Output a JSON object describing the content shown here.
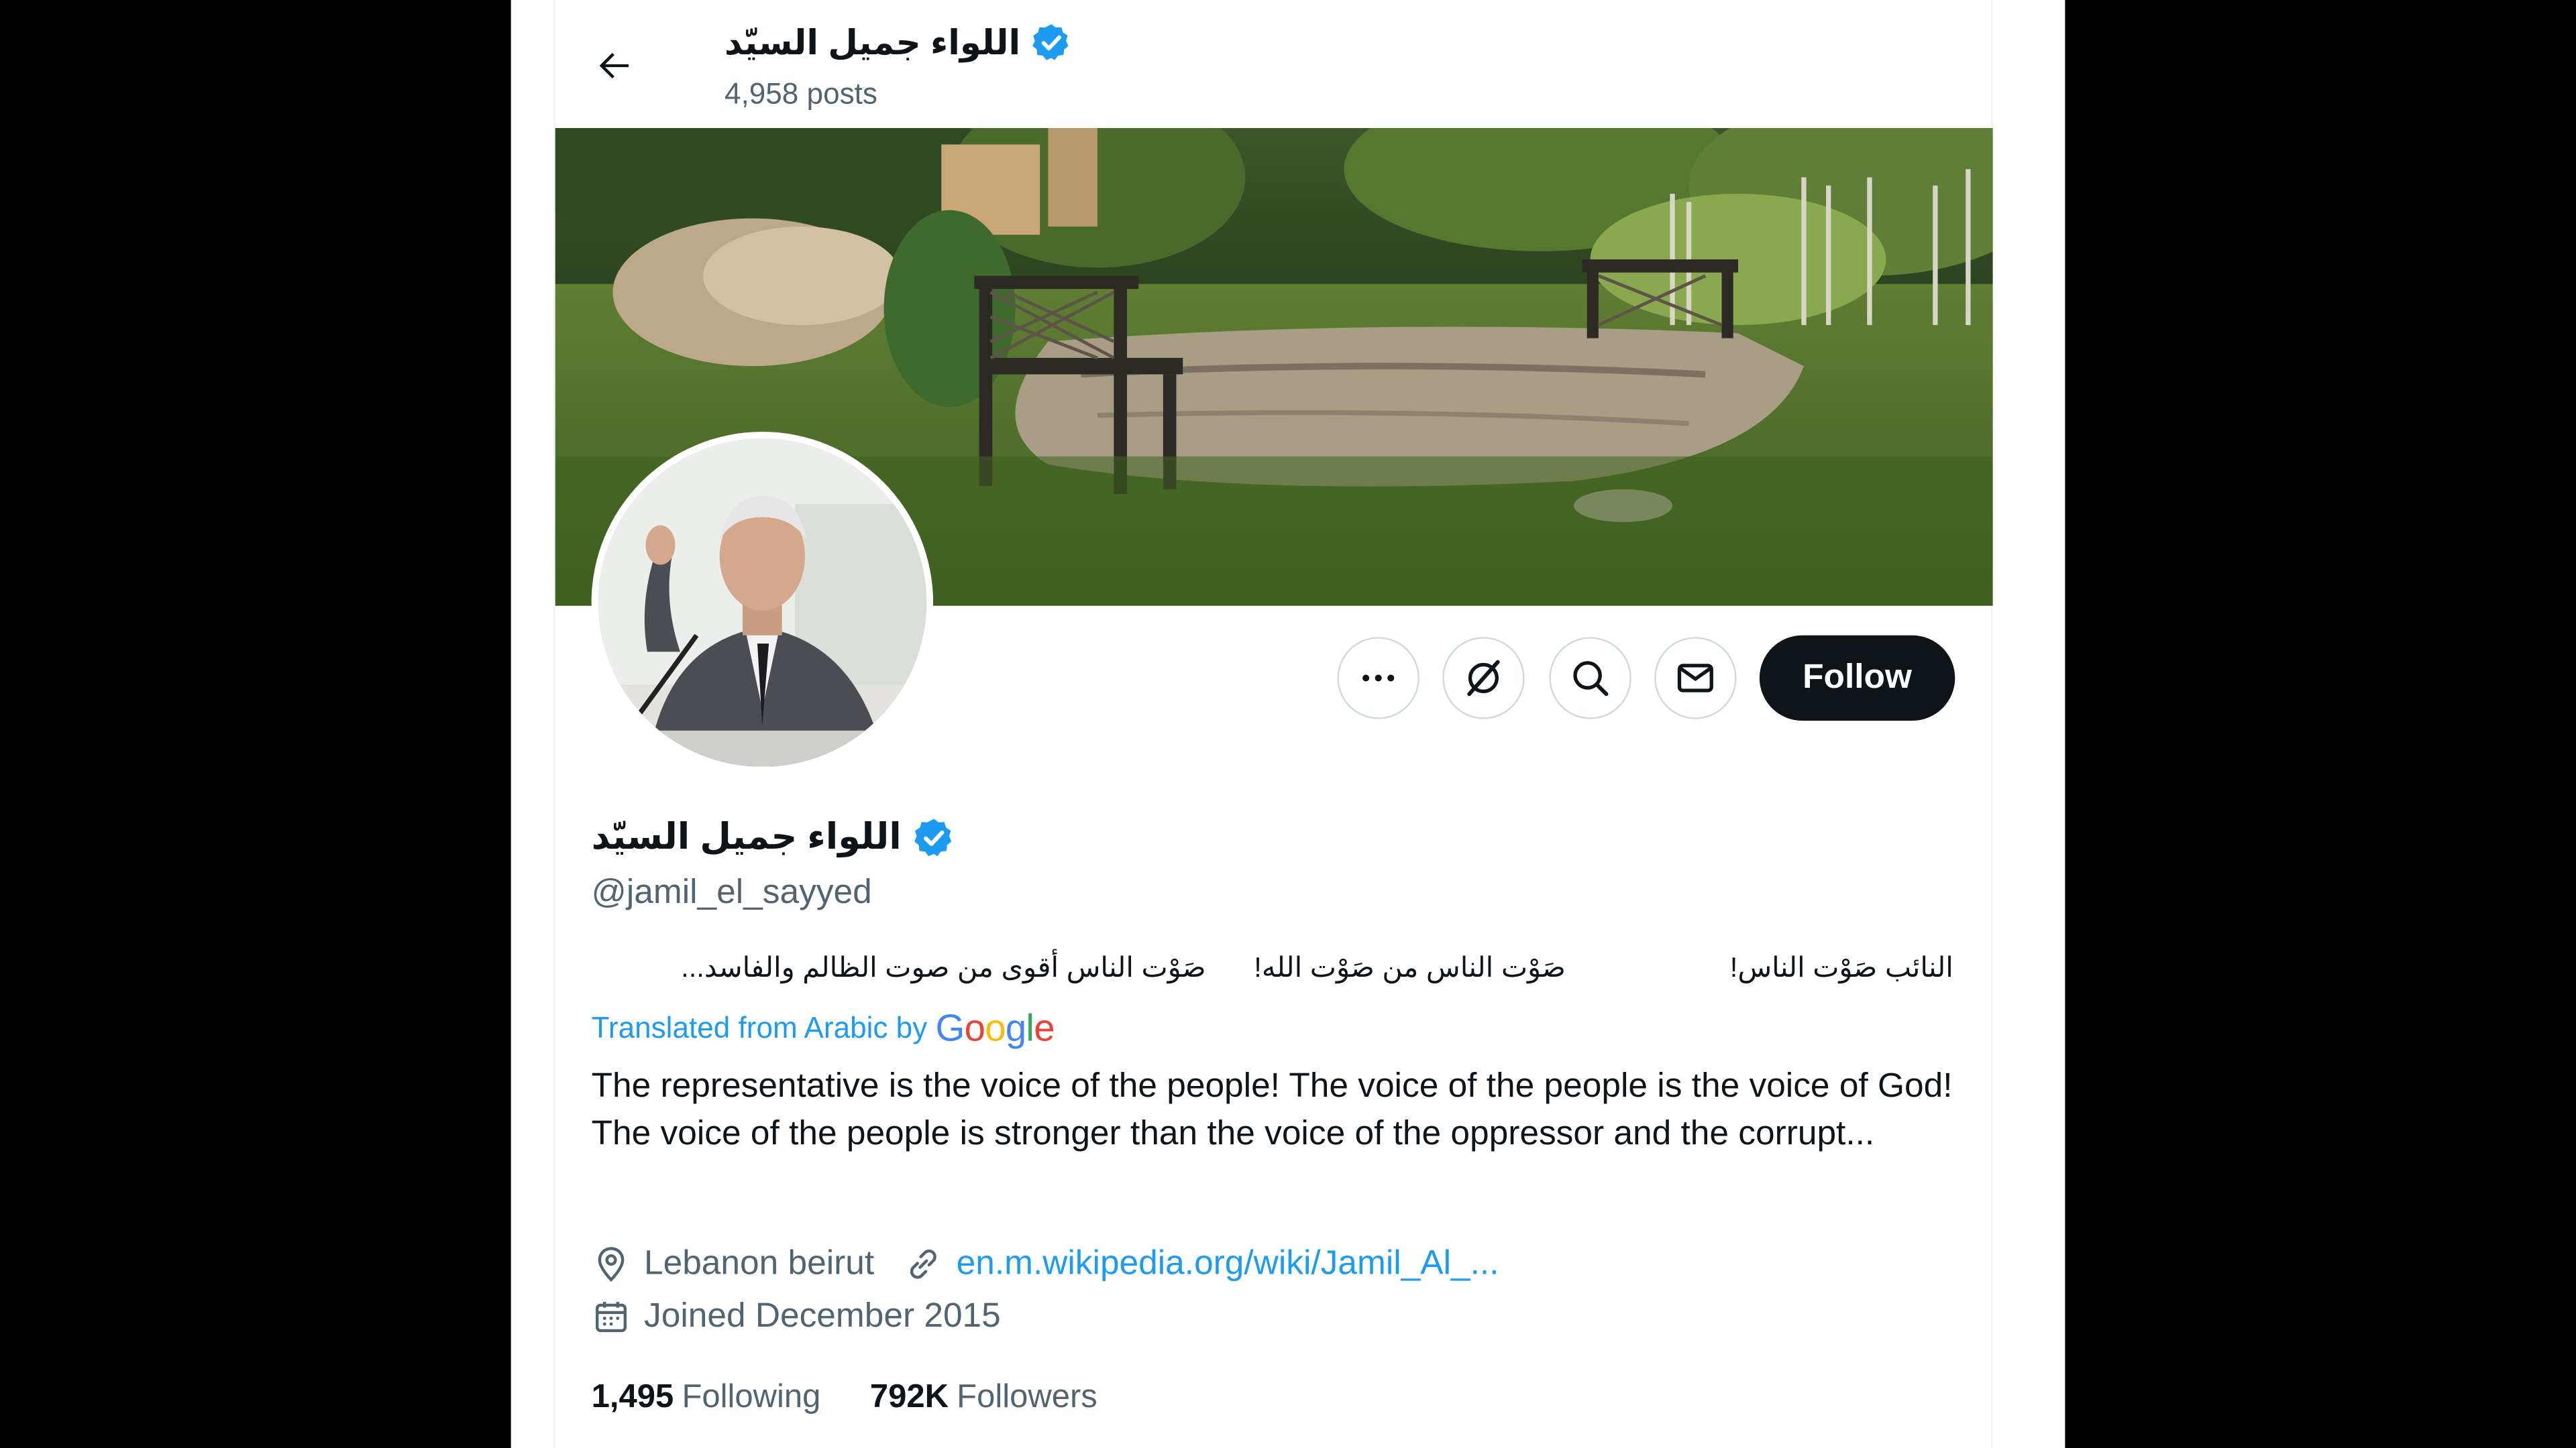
{
  "header": {
    "name": "اللواء جميل السيّد",
    "posts_count": "4,958 posts"
  },
  "profile": {
    "display_name": "اللواء جميل السيّد",
    "handle": "@jamil_el_sayyed",
    "verified": true,
    "bio_original": {
      "part1": "النائب صَوْت الناس!",
      "part2": "صَوْت الناس من صَوْت الله!",
      "part3": "صَوْت الناس أقوى من صوت الظالم والفاسد..."
    },
    "translated_label": "Translated from Arabic by",
    "translator_brand": [
      "G",
      "o",
      "o",
      "g",
      "l",
      "e"
    ],
    "bio_translated": "The representative is the voice of the people! The voice of the people is the voice of God! The voice of the people is stronger than the voice of the oppressor and the corrupt...",
    "location": "Lebanon beirut",
    "website": "en.m.wikipedia.org/wiki/Jamil_Al_...",
    "joined": "Joined December 2015",
    "following_count": "1,495",
    "following_label": "Following",
    "followers_count": "792K",
    "followers_label": "Followers"
  },
  "actions": {
    "follow_label": "Follow",
    "icons": [
      "more-icon",
      "grok-icon",
      "search-icon",
      "message-icon"
    ]
  },
  "colors": {
    "accent": "#1d9bf0",
    "text_primary": "#0f1419",
    "text_secondary": "#536471",
    "follow_bg": "#0f1419",
    "google_blue": "#4285f4",
    "google_red": "#ea4335",
    "google_yellow": "#fbbc05",
    "google_green": "#34a853"
  }
}
